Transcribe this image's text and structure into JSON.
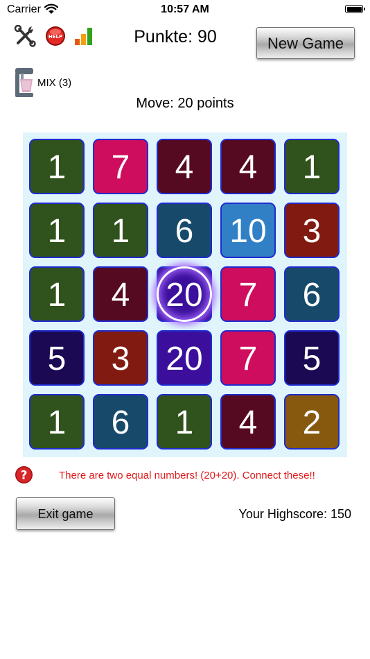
{
  "status_bar": {
    "carrier": "Carrier",
    "time": "10:57 AM"
  },
  "toolbar": {
    "settings_icon": "tools-icon",
    "help_icon": "help-button-icon",
    "stats_icon": "bar-chart-icon"
  },
  "header": {
    "score_text": "Punkte: 90",
    "new_game_label": "New Game"
  },
  "mix": {
    "icon": "mixer-icon",
    "label": "MIX (3)"
  },
  "move_text": "Move: 20 points",
  "board": {
    "rows": 5,
    "cols": 5,
    "tiles": [
      {
        "value": "1",
        "color": "#30521c"
      },
      {
        "value": "7",
        "color": "#ce0d5e"
      },
      {
        "value": "4",
        "color": "#560a21"
      },
      {
        "value": "4",
        "color": "#560a21"
      },
      {
        "value": "1",
        "color": "#30521c"
      },
      {
        "value": "1",
        "color": "#30521c"
      },
      {
        "value": "1",
        "color": "#30521c"
      },
      {
        "value": "6",
        "color": "#174a6a"
      },
      {
        "value": "10",
        "color": "#3180c6"
      },
      {
        "value": "3",
        "color": "#811a10"
      },
      {
        "value": "1",
        "color": "#30521c"
      },
      {
        "value": "4",
        "color": "#560a21"
      },
      {
        "value": "20",
        "color": "#3b0f9c",
        "selected": true
      },
      {
        "value": "7",
        "color": "#ce0d5e"
      },
      {
        "value": "6",
        "color": "#174a6a"
      },
      {
        "value": "5",
        "color": "#1b0953"
      },
      {
        "value": "3",
        "color": "#811a10"
      },
      {
        "value": "20",
        "color": "#3b0f9c"
      },
      {
        "value": "7",
        "color": "#ce0d5e"
      },
      {
        "value": "5",
        "color": "#1b0953"
      },
      {
        "value": "1",
        "color": "#30521c"
      },
      {
        "value": "6",
        "color": "#174a6a"
      },
      {
        "value": "1",
        "color": "#30521c"
      },
      {
        "value": "4",
        "color": "#560a21"
      },
      {
        "value": "2",
        "color": "#86590f"
      }
    ]
  },
  "hint": {
    "icon": "question-icon",
    "text": "There are two equal numbers! (20+20). Connect these!!"
  },
  "footer": {
    "exit_label": "Exit game",
    "highscore_text": "Your Highscore: 150"
  }
}
